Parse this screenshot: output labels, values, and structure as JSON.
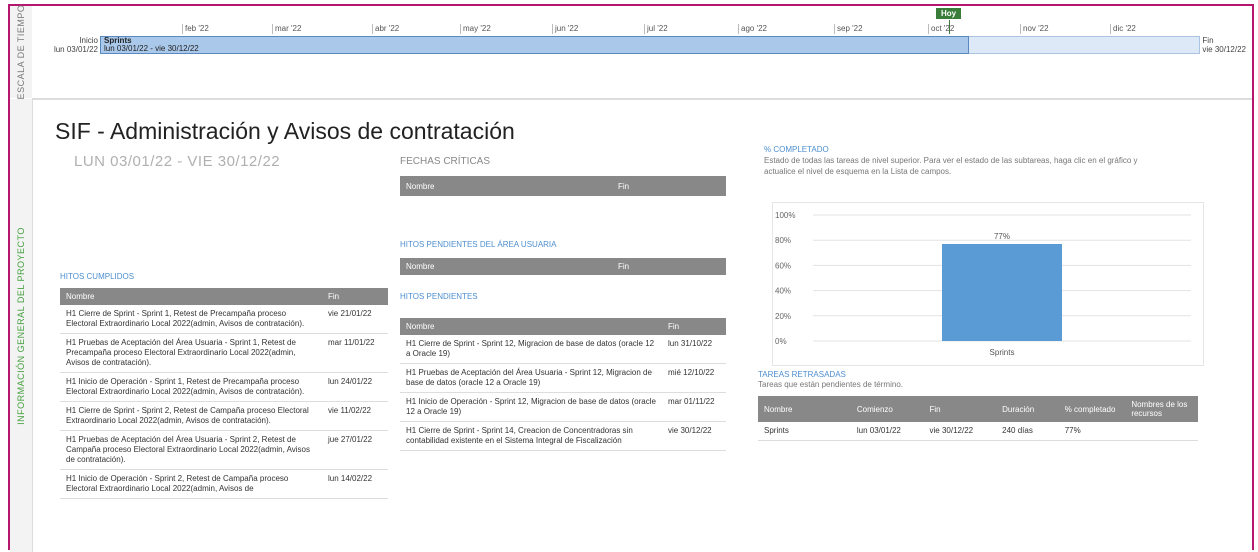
{
  "side_tabs": {
    "timescale": "ESCALA DE TIEMPO",
    "overview": "INFORMACIÓN GENERAL DEL PROYECTO"
  },
  "timeline": {
    "months": [
      "feb '22",
      "mar '22",
      "abr '22",
      "may '22",
      "jun '22",
      "jul '22",
      "ago '22",
      "sep '22",
      "oct '22",
      "nov '22",
      "dic '22"
    ],
    "start_label": "Inicio",
    "start_date": "lun 03/01/22",
    "end_label": "Fin",
    "end_date": "vie 30/12/22",
    "today_label": "Hoy",
    "bar_name": "Sprints",
    "bar_dates": "lun 03/01/22 - vie 30/12/22",
    "progress": 0.79
  },
  "project": {
    "title": "SIF - Administración y Avisos de contratación",
    "dates": "LUN 03/01/22  -  VIE 30/12/22"
  },
  "hitos_cumplidos": {
    "title": "HITOS CUMPLIDOS",
    "headers": [
      "Nombre",
      "Fin"
    ],
    "rows": [
      [
        "H1 Cierre de Sprint - Sprint 1, Retest de Precampaña proceso Electoral Extraordinario Local 2022(admin, Avisos de contratación).",
        "vie 21/01/22"
      ],
      [
        "H1 Pruebas de Aceptación del Área Usuaria - Sprint 1, Retest de Precampaña proceso Electoral Extraordinario Local 2022(admin, Avisos de contratación).",
        "mar 11/01/22"
      ],
      [
        "H1 Inicio de Operación - Sprint 1, Retest de Precampaña proceso Electoral Extraordinario Local 2022(admin, Avisos de contratación).",
        "lun 24/01/22"
      ],
      [
        "H1 Cierre de Sprint - Sprint 2, Retest de Campaña proceso Electoral Extraordinario Local 2022(admin, Avisos de contratación).",
        "vie 11/02/22"
      ],
      [
        "H1 Pruebas de Aceptación del Área Usuaria - Sprint 2, Retest de Campaña proceso Electoral Extraordinario Local 2022(admin, Avisos de contratación).",
        "jue 27/01/22"
      ],
      [
        "H1 Inicio de Operación - Sprint 2, Retest de Campaña proceso Electoral Extraordinario Local 2022(admin, Avisos de",
        "lun 14/02/22"
      ]
    ]
  },
  "fechas_criticas": {
    "title": "FECHAS CRÍTICAS",
    "headers": [
      "Nombre",
      "Fin"
    ]
  },
  "hitos_pend_usuaria": {
    "title": "HITOS PENDIENTES DEL ÁREA USUARIA",
    "headers": [
      "Nombre",
      "Fin"
    ]
  },
  "hitos_pendientes": {
    "title": "HITOS PENDIENTES",
    "headers": [
      "Nombre",
      "Fin"
    ],
    "rows": [
      [
        "H1 Cierre de Sprint - Sprint 12, Migracion de base de datos (oracle 12 a Oracle 19)",
        "lun 31/10/22"
      ],
      [
        "H1 Pruebas de Aceptación del Área Usuaria - Sprint 12, Migracion de base de datos (oracle 12 a Oracle 19)",
        "mié 12/10/22"
      ],
      [
        "H1 Inicio de Operación - Sprint 12, Migracion de base de datos (oracle 12 a Oracle 19)",
        "mar 01/11/22"
      ],
      [
        "H1 Cierre de Sprint - Sprint 14, Creacion de Concentradoras sin contabilidad existente en el Sistema Integral de Fiscalización",
        "vie 30/12/22"
      ]
    ]
  },
  "completado": {
    "title": "% COMPLETADO",
    "desc": "Estado de todas las tareas de nivel superior. Para ver el estado de las subtareas, haga clic en el gráfico y actualice el nivel de esquema en la Lista de campos."
  },
  "chart_data": {
    "type": "bar",
    "categories": [
      "Sprints"
    ],
    "values": [
      77
    ],
    "value_labels": [
      "77%"
    ],
    "ylim": [
      0,
      100
    ],
    "yticks": [
      "0%",
      "20%",
      "40%",
      "60%",
      "80%",
      "100%"
    ],
    "grid": true,
    "bar_color": "#5b9bd5"
  },
  "retrasadas": {
    "title": "TAREAS RETRASADAS",
    "desc": "Tareas que están pendientes de término.",
    "headers": [
      "Nombre",
      "Comienzo",
      "Fin",
      "Duración",
      "% completado",
      "Nombres de los recursos"
    ],
    "rows": [
      [
        "Sprints",
        "lun 03/01/22",
        "vie 30/12/22",
        "240 días",
        "77%",
        ""
      ]
    ]
  },
  "colors": {
    "accent": "#b5176e",
    "header_gray": "#888888",
    "link_blue": "#4d8fd0",
    "side_green": "#45a03f"
  }
}
